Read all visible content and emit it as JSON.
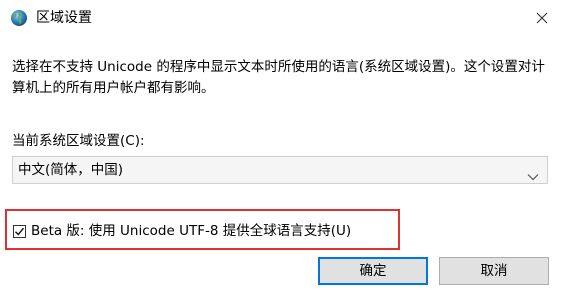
{
  "window": {
    "title": "区域设置",
    "icon": "globe-icon",
    "close_icon": "close-icon"
  },
  "description": "选择在不支持 Unicode 的程序中显示文本时所使用的语言(系统区域设置)。这个设置对计算机上的所有用户帐户都有影响。",
  "system_locale": {
    "label": "当前系统区域设置(C):",
    "selected_value": "中文(简体，中国)"
  },
  "beta_option": {
    "label": "Beta 版: 使用 Unicode UTF-8 提供全球语言支持(U)",
    "checked": true
  },
  "buttons": {
    "ok_label": "确定",
    "cancel_label": "取消"
  },
  "colors": {
    "highlight_border": "#e03131",
    "default_button_border": "#0078d7",
    "button_background": "#e1e1e1"
  }
}
